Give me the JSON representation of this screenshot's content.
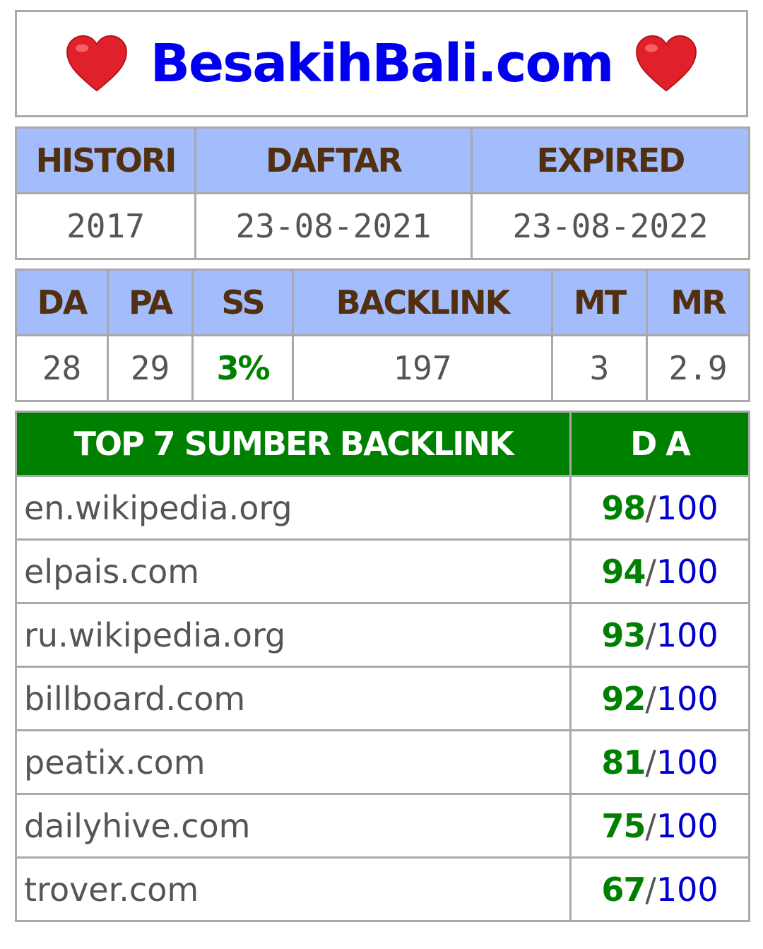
{
  "title": {
    "heart_left": "heart-icon",
    "site": "BesakihBali.com",
    "heart_right": "heart-icon",
    "site_color": "#0000ee",
    "heart_color": "#e0202a"
  },
  "info": {
    "headers": [
      "HISTORI",
      "DAFTAR",
      "EXPIRED"
    ],
    "values": [
      "2017",
      "23-08-2021",
      "23-08-2022"
    ]
  },
  "metrics": {
    "headers": [
      "DA",
      "PA",
      "SS",
      "BACKLINK",
      "MT",
      "MR"
    ],
    "values": [
      "28",
      "29",
      "3%",
      "197",
      "3",
      "2.9"
    ]
  },
  "backlinks": {
    "header_source": "TOP 7 SUMBER BACKLINK",
    "header_da": "D A",
    "slash": "/",
    "max": "100",
    "rows": [
      {
        "domain": "en.wikipedia.org",
        "da": "98"
      },
      {
        "domain": "elpais.com",
        "da": "94"
      },
      {
        "domain": "ru.wikipedia.org",
        "da": "93"
      },
      {
        "domain": "billboard.com",
        "da": "92"
      },
      {
        "domain": "peatix.com",
        "da": "81"
      },
      {
        "domain": "dailyhive.com",
        "da": "75"
      },
      {
        "domain": "trover.com",
        "da": "67"
      }
    ]
  },
  "colors": {
    "header_bg": "#a3bcfb",
    "header_text": "#52300f",
    "green": "#008000",
    "border": "#a9a9a9"
  }
}
